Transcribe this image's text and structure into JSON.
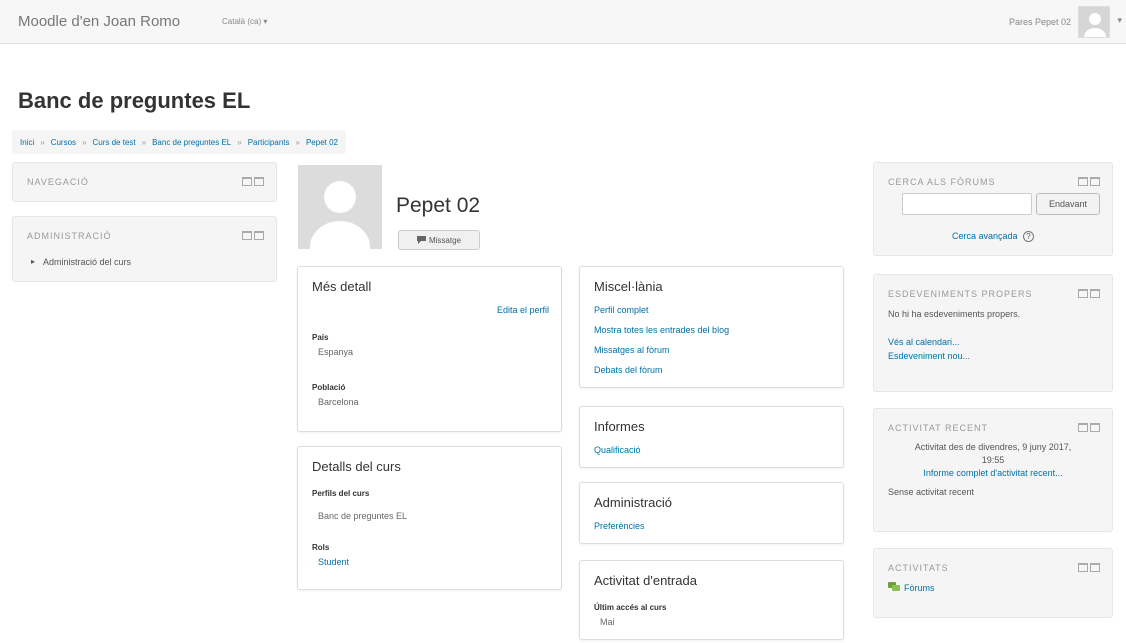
{
  "navbar": {
    "brand": "Moodle d'en Joan Romo",
    "language": "Català (ca) ▾",
    "user_name": "Pares Pepet 02",
    "caret": "▾"
  },
  "page_title": "Banc de preguntes EL",
  "breadcrumb": [
    "Inici",
    "Cursos",
    "Curs de test",
    "Banc de preguntes EL",
    "Participants",
    "Pepet 02"
  ],
  "breadcrumb_sep": "»",
  "left_blocks": {
    "navigation": {
      "title": "NAVEGACIÓ"
    },
    "administration": {
      "title": "ADMINISTRACIÓ",
      "item": "Administració del curs"
    }
  },
  "profile": {
    "name": "Pepet 02",
    "message_button": "Missatge",
    "message_icon": "chat-icon"
  },
  "more_details": {
    "title": "Més detall",
    "edit_link": "Edita el perfil",
    "country_label": "País",
    "country_value": "Espanya",
    "city_label": "Població",
    "city_value": "Barcelona"
  },
  "course_details": {
    "title": "Detalls del curs",
    "profiles_label": "Perfils del curs",
    "profiles_value": "Banc de preguntes EL",
    "roles_label": "Rols",
    "roles_value": "Student"
  },
  "misc": {
    "title": "Miscel·lània",
    "links": [
      "Perfil complet",
      "Mostra totes les entrades del blog",
      "Missatges al fòrum",
      "Debats del fòrum"
    ]
  },
  "reports": {
    "title": "Informes",
    "link": "Qualificació"
  },
  "admin": {
    "title": "Administració",
    "link": "Preferències"
  },
  "login_activity": {
    "title": "Activitat d'entrada",
    "last_access_label": "Últim accés al curs",
    "last_access_value": "Mai"
  },
  "right_blocks": {
    "search": {
      "title": "CERCA ALS FÒRUMS",
      "button": "Endavant",
      "advanced": "Cerca avançada",
      "help": "?"
    },
    "events": {
      "title": "ESDEVENIMENTS PROPERS",
      "empty": "No hi ha esdeveniments propers.",
      "calendar_link": "Vés al calendari...",
      "new_event_link": "Esdeveniment nou..."
    },
    "recent": {
      "title": "ACTIVITAT RECENT",
      "since_line1": "Activitat des de divendres, 9 juny 2017,",
      "since_line2": "19:55",
      "full_report": "Informe complet d'activitat recent...",
      "none": "Sense activitat recent"
    },
    "activities": {
      "title": "ACTIVITATS",
      "forums": "Fòrums"
    }
  },
  "colors": {
    "link": "#0070a8",
    "navbar_bg": "#f7f7f7",
    "block_bg": "#f5f5f5"
  }
}
